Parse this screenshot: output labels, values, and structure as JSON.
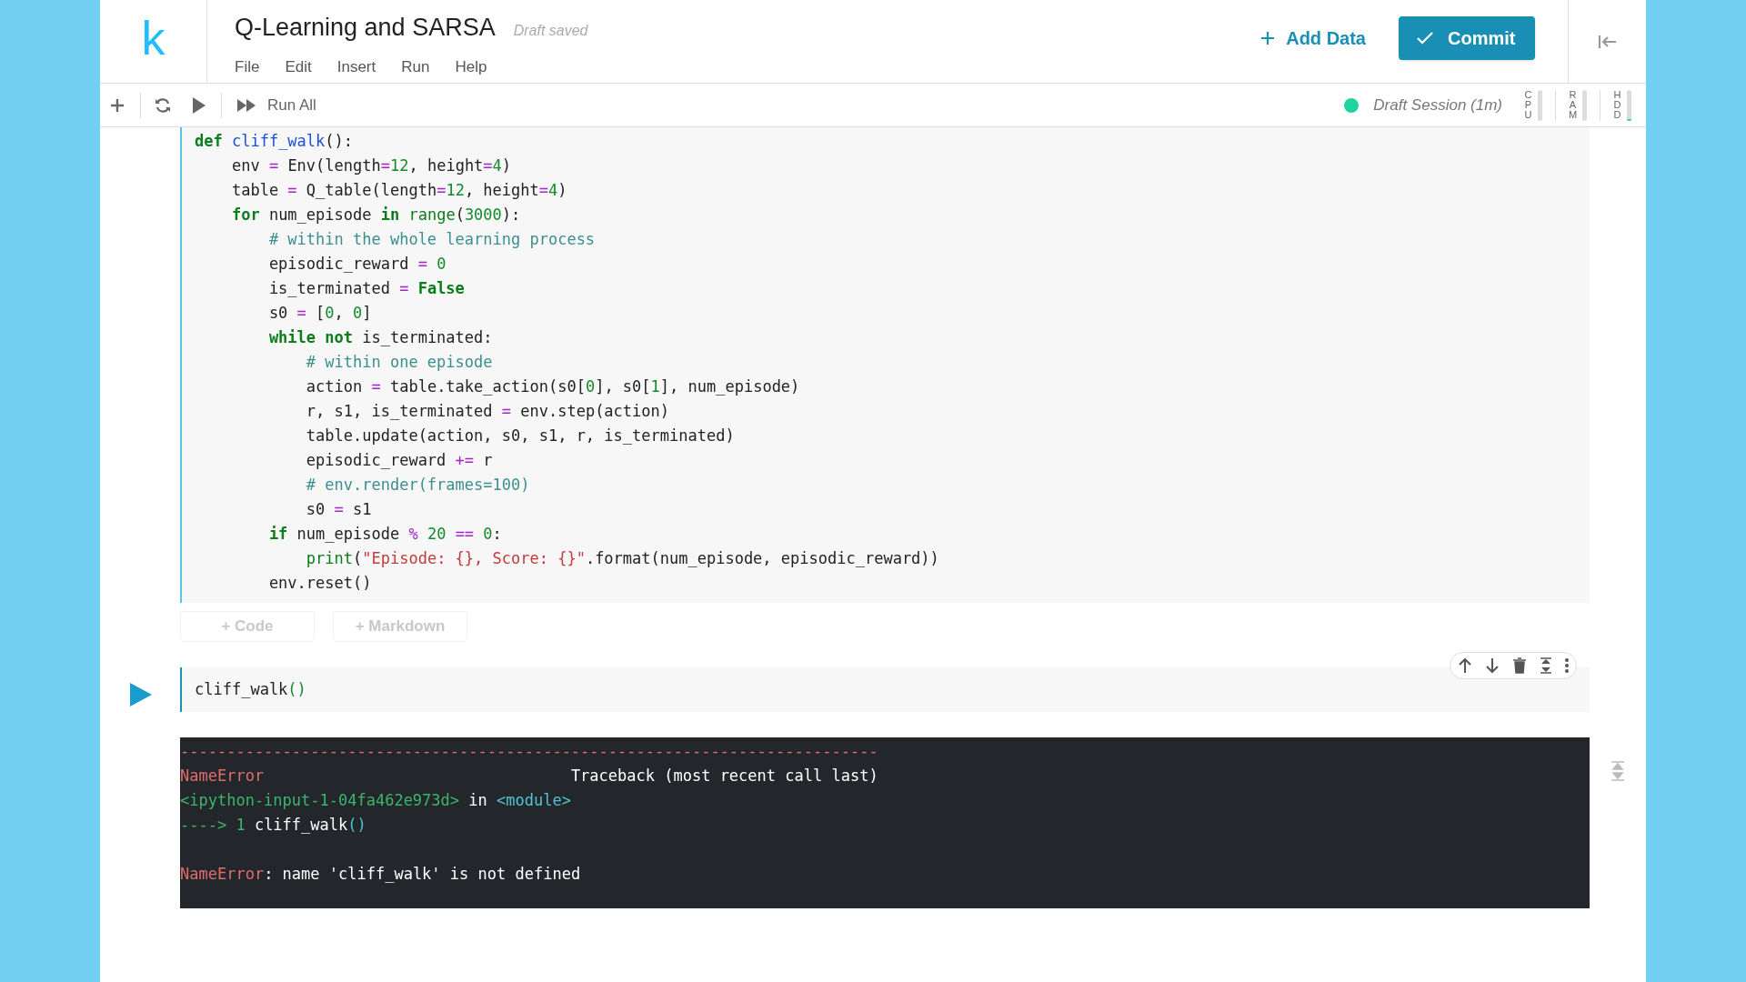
{
  "header": {
    "logo": "k",
    "title": "Q-Learning and SARSA",
    "save_status": "Draft saved",
    "menu": [
      "File",
      "Edit",
      "Insert",
      "Run",
      "Help"
    ],
    "add_data": "Add Data",
    "commit": "Commit"
  },
  "toolbar": {
    "run_all": "Run All",
    "session": "Draft Session (1m)",
    "meters": [
      {
        "label": "CPU",
        "level": 0
      },
      {
        "label": "RAM",
        "level": 0
      },
      {
        "label": "HDD",
        "level": 0.05
      }
    ]
  },
  "cells": [
    {
      "kind": "code",
      "selected": true,
      "lines": [
        [
          {
            "text": "def ",
            "kind": "kw"
          },
          {
            "text": "cliff_walk",
            "kind": "fn"
          },
          {
            "text": "():",
            "kind": "plain"
          }
        ],
        [
          {
            "text": "    env ",
            "kind": "plain"
          },
          {
            "text": "=",
            "kind": "op"
          },
          {
            "text": " Env(length",
            "kind": "plain"
          },
          {
            "text": "=",
            "kind": "op"
          },
          {
            "text": "12",
            "kind": "num"
          },
          {
            "text": ", height",
            "kind": "plain"
          },
          {
            "text": "=",
            "kind": "op"
          },
          {
            "text": "4",
            "kind": "num"
          },
          {
            "text": ")",
            "kind": "plain"
          }
        ],
        [
          {
            "text": "    table ",
            "kind": "plain"
          },
          {
            "text": "=",
            "kind": "op"
          },
          {
            "text": " Q_table(length",
            "kind": "plain"
          },
          {
            "text": "=",
            "kind": "op"
          },
          {
            "text": "12",
            "kind": "num"
          },
          {
            "text": ", height",
            "kind": "plain"
          },
          {
            "text": "=",
            "kind": "op"
          },
          {
            "text": "4",
            "kind": "num"
          },
          {
            "text": ")",
            "kind": "plain"
          }
        ],
        [
          {
            "text": "    for",
            "kind": "kw"
          },
          {
            "text": " num_episode ",
            "kind": "plain"
          },
          {
            "text": "in",
            "kind": "kw"
          },
          {
            "text": " range",
            "kind": "builtin"
          },
          {
            "text": "(",
            "kind": "plain"
          },
          {
            "text": "3000",
            "kind": "num"
          },
          {
            "text": "):",
            "kind": "plain"
          }
        ],
        [
          {
            "text": "        # within the whole learning process",
            "kind": "comment"
          }
        ],
        [
          {
            "text": "        episodic_reward ",
            "kind": "plain"
          },
          {
            "text": "=",
            "kind": "op"
          },
          {
            "text": " 0",
            "kind": "num"
          }
        ],
        [
          {
            "text": "        is_terminated ",
            "kind": "plain"
          },
          {
            "text": "=",
            "kind": "op"
          },
          {
            "text": " False",
            "kind": "kw"
          }
        ],
        [
          {
            "text": "        s0 ",
            "kind": "plain"
          },
          {
            "text": "=",
            "kind": "op"
          },
          {
            "text": " [",
            "kind": "plain"
          },
          {
            "text": "0",
            "kind": "num"
          },
          {
            "text": ", ",
            "kind": "plain"
          },
          {
            "text": "0",
            "kind": "num"
          },
          {
            "text": "]",
            "kind": "plain"
          }
        ],
        [
          {
            "text": "        while not",
            "kind": "kw"
          },
          {
            "text": " is_terminated:",
            "kind": "plain"
          }
        ],
        [
          {
            "text": "            # within one episode",
            "kind": "comment"
          }
        ],
        [
          {
            "text": "            action ",
            "kind": "plain"
          },
          {
            "text": "=",
            "kind": "op"
          },
          {
            "text": " table.take_action(s0[",
            "kind": "plain"
          },
          {
            "text": "0",
            "kind": "num"
          },
          {
            "text": "], s0[",
            "kind": "plain"
          },
          {
            "text": "1",
            "kind": "num"
          },
          {
            "text": "], num_episode)",
            "kind": "plain"
          }
        ],
        [
          {
            "text": "            r, s1, is_terminated ",
            "kind": "plain"
          },
          {
            "text": "=",
            "kind": "op"
          },
          {
            "text": " env.step(action)",
            "kind": "plain"
          }
        ],
        [
          {
            "text": "            table.update(action, s0, s1, r, is_terminated)",
            "kind": "plain"
          }
        ],
        [
          {
            "text": "            episodic_reward ",
            "kind": "plain"
          },
          {
            "text": "+=",
            "kind": "op"
          },
          {
            "text": " r",
            "kind": "plain"
          }
        ],
        [
          {
            "text": "            # env.render(frames=100)",
            "kind": "comment"
          }
        ],
        [
          {
            "text": "            s0 ",
            "kind": "plain"
          },
          {
            "text": "=",
            "kind": "op"
          },
          {
            "text": " s1",
            "kind": "plain"
          }
        ],
        [
          {
            "text": "        if",
            "kind": "kw"
          },
          {
            "text": " num_episode ",
            "kind": "plain"
          },
          {
            "text": "%",
            "kind": "op"
          },
          {
            "text": " 20 ",
            "kind": "num"
          },
          {
            "text": "==",
            "kind": "op"
          },
          {
            "text": " 0",
            "kind": "num"
          },
          {
            "text": ":",
            "kind": "plain"
          }
        ],
        [
          {
            "text": "            print",
            "kind": "builtin"
          },
          {
            "text": "(",
            "kind": "plain"
          },
          {
            "text": "\"Episode: {}, Score: {}\"",
            "kind": "string"
          },
          {
            "text": ".format(num_episode, episodic_reward))",
            "kind": "plain"
          }
        ],
        [
          {
            "text": "        env.reset()",
            "kind": "plain"
          }
        ]
      ]
    },
    {
      "kind": "code",
      "selected": false,
      "lines": [
        [
          {
            "text": "cliff_walk",
            "kind": "plain"
          },
          {
            "text": "()",
            "kind": "num"
          }
        ]
      ],
      "output": [
        {
          "kind": "trace",
          "spans": [
            {
              "text": "---------------------------------------------------------------------------",
              "kind": "error"
            }
          ]
        },
        {
          "kind": "trace",
          "spans": [
            {
              "text": "NameError",
              "kind": "error"
            },
            {
              "text": "                                 Traceback (most recent call last)",
              "kind": "plain"
            }
          ]
        },
        {
          "kind": "trace",
          "spans": [
            {
              "text": "<ipython-input-1-04fa462e973d>",
              "kind": "num"
            },
            {
              "text": " in ",
              "kind": "plain"
            },
            {
              "text": "<module>",
              "kind": "cyan"
            }
          ]
        },
        {
          "kind": "trace",
          "spans": [
            {
              "text": "----> 1 ",
              "kind": "num"
            },
            {
              "text": "cliff_walk",
              "kind": "plain"
            },
            {
              "text": "()",
              "kind": "cyan"
            }
          ]
        },
        {
          "kind": "message",
          "spans": [
            {
              "text": "NameError",
              "kind": "error"
            },
            {
              "text": ": name 'cliff_walk' is not defined",
              "kind": "plain"
            }
          ]
        }
      ]
    }
  ],
  "add_cell": [
    "+ Code",
    "+ Markdown"
  ]
}
